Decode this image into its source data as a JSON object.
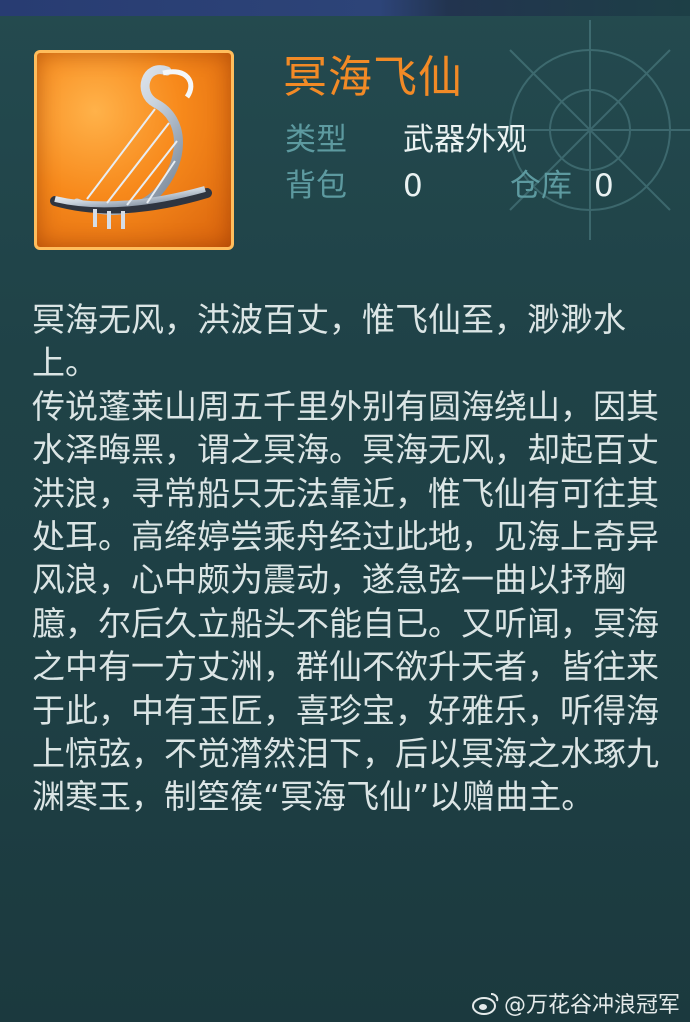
{
  "item": {
    "name": "冥海飞仙",
    "type_label": "类型",
    "type_value": "武器外观",
    "bag_label": "背包",
    "bag_count": "0",
    "warehouse_label": "仓库",
    "warehouse_count": "0",
    "icon": "harp-weapon-icon"
  },
  "description": "冥海无风，洪波百丈，惟飞仙至，渺渺水上。\n传说蓬莱山周五千里外别有圆海绕山，因其水泽晦黑，谓之冥海。冥海无风，却起百丈洪浪，寻常船只无法靠近，惟飞仙有可往其处耳。高绛婷尝乘舟经过此地，见海上奇异风浪，心中颇为震动，遂急弦一曲以抒胸臆，尔后久立船头不能自已。又听闻，冥海之中有一方丈洲，群仙不欲升天者，皆往来于此，中有玉匠，喜珍宝，好雅乐，听得海上惊弦，不觉潸然泪下，后以冥海之水琢九渊寒玉，制箜篌“冥海飞仙”以赠曲主。",
  "watermark": {
    "icon": "weibo-icon",
    "text": "@万花谷冲浪冠军"
  },
  "colors": {
    "background": "#1f4247",
    "title": "#f28a26",
    "label": "#5d9aa0",
    "value": "#eaf2f2",
    "body_text": "#dbe5e5",
    "icon_bg": "#f7891b"
  }
}
